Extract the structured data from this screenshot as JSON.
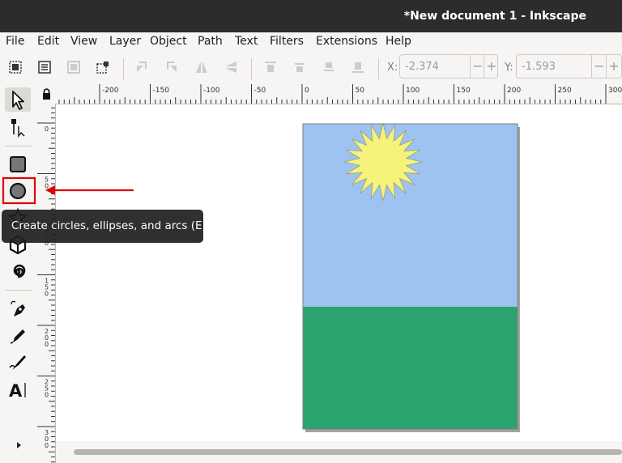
{
  "window": {
    "title": "*New document 1 - Inkscape"
  },
  "menu": [
    "File",
    "Edit",
    "View",
    "Layer",
    "Object",
    "Path",
    "Text",
    "Filters",
    "Extensions",
    "Help"
  ],
  "toolbar": {
    "x_label": "X:",
    "x_value": "-2.374",
    "y_label": "Y:",
    "y_value": "-1.593",
    "minus": "−",
    "plus": "+"
  },
  "rulers": {
    "top_ticks": [
      "-200",
      "-150",
      "-100",
      "-50",
      "0",
      "50",
      "100",
      "150",
      "200",
      "250",
      "300"
    ],
    "left_ticks": [
      "0",
      "50",
      "100",
      "150",
      "200",
      "250",
      "300"
    ]
  },
  "tooltip": {
    "text": "Create circles, ellipses, and arcs (E)"
  },
  "colors": {
    "sky": "#9ec3f0",
    "grass": "#2aa36e",
    "sun": "#f6f27a",
    "highlight": "#e00000"
  }
}
